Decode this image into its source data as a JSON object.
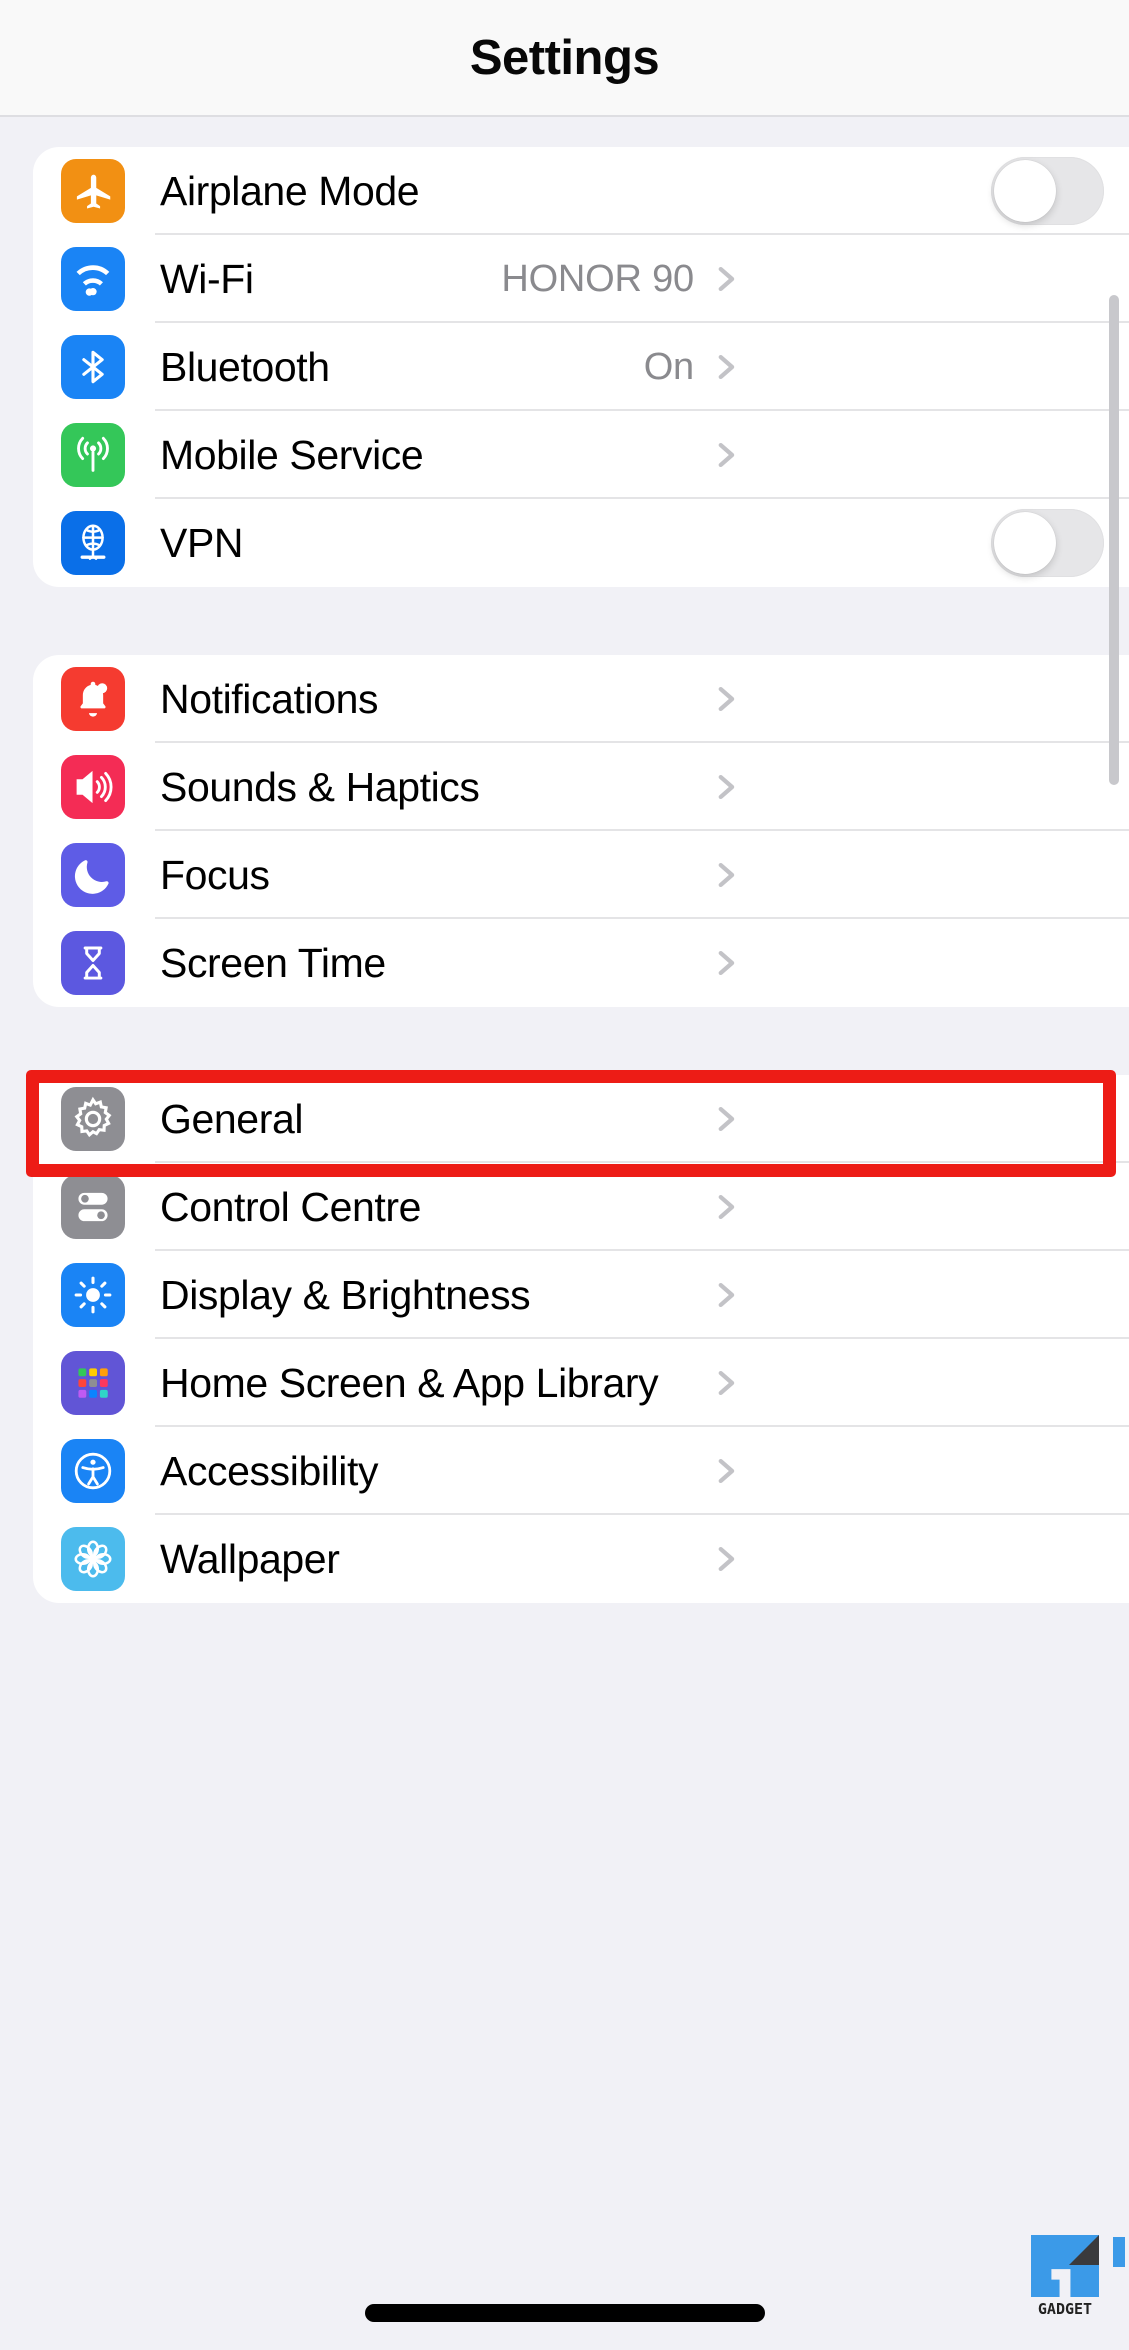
{
  "header": {
    "title": "Settings"
  },
  "groups": [
    {
      "id": "connectivity",
      "rows": [
        {
          "label": "Airplane Mode",
          "icon": "airplane-icon",
          "icon_color": "#f29013",
          "accessory": "toggle",
          "toggle_on": false
        },
        {
          "label": "Wi-Fi",
          "icon": "wifi-icon",
          "icon_color": "#1a84f5",
          "accessory": "value",
          "value": "HONOR 90"
        },
        {
          "label": "Bluetooth",
          "icon": "bluetooth-icon",
          "icon_color": "#1a84f5",
          "accessory": "value",
          "value": "On"
        },
        {
          "label": "Mobile Service",
          "icon": "antenna-icon",
          "icon_color": "#34c759",
          "accessory": "chevron"
        },
        {
          "label": "VPN",
          "icon": "globe-vpn-icon",
          "icon_color": "#0a6fe8",
          "accessory": "toggle",
          "toggle_on": false
        }
      ]
    },
    {
      "id": "alerts",
      "rows": [
        {
          "label": "Notifications",
          "icon": "bell-icon",
          "icon_color": "#f53b30",
          "accessory": "chevron"
        },
        {
          "label": "Sounds & Haptics",
          "icon": "speaker-icon",
          "icon_color": "#f42c55",
          "accessory": "chevron"
        },
        {
          "label": "Focus",
          "icon": "moon-icon",
          "icon_color": "#5e5ce6",
          "accessory": "chevron"
        },
        {
          "label": "Screen Time",
          "icon": "hourglass-icon",
          "icon_color": "#5c58e0",
          "accessory": "chevron"
        }
      ]
    },
    {
      "id": "system",
      "rows": [
        {
          "label": "General",
          "icon": "gear-icon",
          "icon_color": "#8e8e93",
          "accessory": "chevron",
          "highlighted": true
        },
        {
          "label": "Control Centre",
          "icon": "sliders-icon",
          "icon_color": "#8e8e93",
          "accessory": "chevron"
        },
        {
          "label": "Display & Brightness",
          "icon": "brightness-icon",
          "icon_color": "#1a84f5",
          "accessory": "chevron"
        },
        {
          "label": "Home Screen & App Library",
          "icon": "app-grid-icon",
          "icon_color": "#6155d6",
          "accessory": "chevron"
        },
        {
          "label": "Accessibility",
          "icon": "accessibility-icon",
          "icon_color": "#1a84f5",
          "accessory": "chevron"
        },
        {
          "label": "Wallpaper",
          "icon": "flower-icon",
          "icon_color": "#4cbbed",
          "accessory": "chevron"
        }
      ]
    }
  ],
  "watermark": {
    "text": "GADGET"
  },
  "colors": {
    "page_background": "#f1f1f6",
    "card_background": "#ffffff",
    "navbar_background": "#f9f9f9",
    "highlight_red": "#ed1c16",
    "separator": "#e4e4e6",
    "value_text": "#8a8a8e",
    "chevron": "#c3c3c7"
  }
}
